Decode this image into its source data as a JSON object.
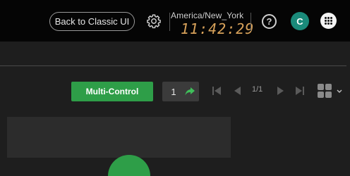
{
  "header": {
    "classic_ui_label": "Back to Classic UI",
    "settings_icon": "gear-icon",
    "clock": {
      "timezone": "America/New_York",
      "time": "11:42:29"
    },
    "help_icon": "help-icon",
    "help_glyph": "?",
    "avatar_letter": "C",
    "avatar_color": "#1a8a7a",
    "apps_icon": "grid-icon"
  },
  "toolbar": {
    "multi_control_label": "Multi-Control",
    "multi_control_color": "#2e9e48",
    "page_input_value": "1",
    "go_icon": "share-arrow-icon",
    "page_count": "1/1",
    "nav_icons": [
      "first-page-icon",
      "prev-page-icon",
      "next-page-icon",
      "last-page-icon"
    ],
    "layout_icon": "layout-grid-icon"
  },
  "colors": {
    "background": "#1e1e1e",
    "topbar": "#050505",
    "clock_digits": "#d8a25a",
    "accent_green": "#2e9e48"
  }
}
